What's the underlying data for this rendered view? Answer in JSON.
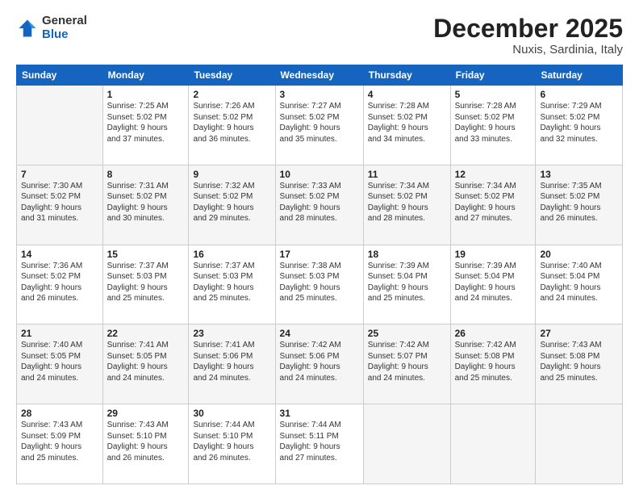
{
  "logo": {
    "general": "General",
    "blue": "Blue"
  },
  "title": "December 2025",
  "location": "Nuxis, Sardinia, Italy",
  "days_of_week": [
    "Sunday",
    "Monday",
    "Tuesday",
    "Wednesday",
    "Thursday",
    "Friday",
    "Saturday"
  ],
  "weeks": [
    [
      {
        "day": "",
        "info": ""
      },
      {
        "day": "1",
        "info": "Sunrise: 7:25 AM\nSunset: 5:02 PM\nDaylight: 9 hours\nand 37 minutes."
      },
      {
        "day": "2",
        "info": "Sunrise: 7:26 AM\nSunset: 5:02 PM\nDaylight: 9 hours\nand 36 minutes."
      },
      {
        "day": "3",
        "info": "Sunrise: 7:27 AM\nSunset: 5:02 PM\nDaylight: 9 hours\nand 35 minutes."
      },
      {
        "day": "4",
        "info": "Sunrise: 7:28 AM\nSunset: 5:02 PM\nDaylight: 9 hours\nand 34 minutes."
      },
      {
        "day": "5",
        "info": "Sunrise: 7:28 AM\nSunset: 5:02 PM\nDaylight: 9 hours\nand 33 minutes."
      },
      {
        "day": "6",
        "info": "Sunrise: 7:29 AM\nSunset: 5:02 PM\nDaylight: 9 hours\nand 32 minutes."
      }
    ],
    [
      {
        "day": "7",
        "info": "Sunrise: 7:30 AM\nSunset: 5:02 PM\nDaylight: 9 hours\nand 31 minutes."
      },
      {
        "day": "8",
        "info": "Sunrise: 7:31 AM\nSunset: 5:02 PM\nDaylight: 9 hours\nand 30 minutes."
      },
      {
        "day": "9",
        "info": "Sunrise: 7:32 AM\nSunset: 5:02 PM\nDaylight: 9 hours\nand 29 minutes."
      },
      {
        "day": "10",
        "info": "Sunrise: 7:33 AM\nSunset: 5:02 PM\nDaylight: 9 hours\nand 28 minutes."
      },
      {
        "day": "11",
        "info": "Sunrise: 7:34 AM\nSunset: 5:02 PM\nDaylight: 9 hours\nand 28 minutes."
      },
      {
        "day": "12",
        "info": "Sunrise: 7:34 AM\nSunset: 5:02 PM\nDaylight: 9 hours\nand 27 minutes."
      },
      {
        "day": "13",
        "info": "Sunrise: 7:35 AM\nSunset: 5:02 PM\nDaylight: 9 hours\nand 26 minutes."
      }
    ],
    [
      {
        "day": "14",
        "info": "Sunrise: 7:36 AM\nSunset: 5:02 PM\nDaylight: 9 hours\nand 26 minutes."
      },
      {
        "day": "15",
        "info": "Sunrise: 7:37 AM\nSunset: 5:03 PM\nDaylight: 9 hours\nand 25 minutes."
      },
      {
        "day": "16",
        "info": "Sunrise: 7:37 AM\nSunset: 5:03 PM\nDaylight: 9 hours\nand 25 minutes."
      },
      {
        "day": "17",
        "info": "Sunrise: 7:38 AM\nSunset: 5:03 PM\nDaylight: 9 hours\nand 25 minutes."
      },
      {
        "day": "18",
        "info": "Sunrise: 7:39 AM\nSunset: 5:04 PM\nDaylight: 9 hours\nand 25 minutes."
      },
      {
        "day": "19",
        "info": "Sunrise: 7:39 AM\nSunset: 5:04 PM\nDaylight: 9 hours\nand 24 minutes."
      },
      {
        "day": "20",
        "info": "Sunrise: 7:40 AM\nSunset: 5:04 PM\nDaylight: 9 hours\nand 24 minutes."
      }
    ],
    [
      {
        "day": "21",
        "info": "Sunrise: 7:40 AM\nSunset: 5:05 PM\nDaylight: 9 hours\nand 24 minutes."
      },
      {
        "day": "22",
        "info": "Sunrise: 7:41 AM\nSunset: 5:05 PM\nDaylight: 9 hours\nand 24 minutes."
      },
      {
        "day": "23",
        "info": "Sunrise: 7:41 AM\nSunset: 5:06 PM\nDaylight: 9 hours\nand 24 minutes."
      },
      {
        "day": "24",
        "info": "Sunrise: 7:42 AM\nSunset: 5:06 PM\nDaylight: 9 hours\nand 24 minutes."
      },
      {
        "day": "25",
        "info": "Sunrise: 7:42 AM\nSunset: 5:07 PM\nDaylight: 9 hours\nand 24 minutes."
      },
      {
        "day": "26",
        "info": "Sunrise: 7:42 AM\nSunset: 5:08 PM\nDaylight: 9 hours\nand 25 minutes."
      },
      {
        "day": "27",
        "info": "Sunrise: 7:43 AM\nSunset: 5:08 PM\nDaylight: 9 hours\nand 25 minutes."
      }
    ],
    [
      {
        "day": "28",
        "info": "Sunrise: 7:43 AM\nSunset: 5:09 PM\nDaylight: 9 hours\nand 25 minutes."
      },
      {
        "day": "29",
        "info": "Sunrise: 7:43 AM\nSunset: 5:10 PM\nDaylight: 9 hours\nand 26 minutes."
      },
      {
        "day": "30",
        "info": "Sunrise: 7:44 AM\nSunset: 5:10 PM\nDaylight: 9 hours\nand 26 minutes."
      },
      {
        "day": "31",
        "info": "Sunrise: 7:44 AM\nSunset: 5:11 PM\nDaylight: 9 hours\nand 27 minutes."
      },
      {
        "day": "",
        "info": ""
      },
      {
        "day": "",
        "info": ""
      },
      {
        "day": "",
        "info": ""
      }
    ]
  ]
}
